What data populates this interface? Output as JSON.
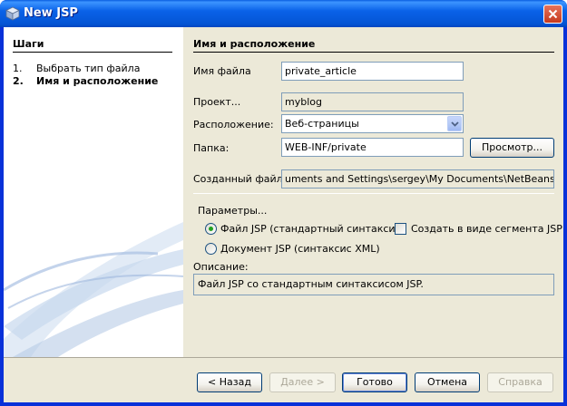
{
  "window": {
    "title": "New JSP",
    "icon": "netbeans-cube-icon"
  },
  "steps": {
    "title": "Шаги",
    "items": [
      {
        "num": "1.",
        "label": "Выбрать тип файла",
        "current": false
      },
      {
        "num": "2.",
        "label": "Имя и расположение",
        "current": true
      }
    ]
  },
  "form": {
    "section_title": "Имя и расположение",
    "file_name": {
      "label": "Имя файла",
      "value": "private_article"
    },
    "project": {
      "label": "Проект...",
      "value": "myblog"
    },
    "location": {
      "label": "Расположение:",
      "value": "Веб-страницы"
    },
    "folder": {
      "label": "Папка:",
      "value": "WEB-INF/private",
      "browse_label": "Просмотр..."
    },
    "created_file": {
      "label": "Созданный файл:",
      "value": "uments and Settings\\sergey\\My Documents\\NetBeansProjects"
    }
  },
  "params": {
    "title": "Параметры...",
    "radio_jsp": {
      "label": "Файл JSP (стандартный синтаксис)",
      "selected": true
    },
    "radio_xml": {
      "label": "Документ JSP (синтаксис XML)",
      "selected": false
    },
    "segment_checkbox": {
      "label": "Создать в виде сегмента JSP",
      "checked": false
    },
    "description_label": "Описание:",
    "description_text": "Файл JSP со стандартным синтаксисом JSP."
  },
  "buttons": {
    "back": "< Назад",
    "next": "Далее >",
    "finish": "Готово",
    "cancel": "Отмена",
    "help": "Справка"
  },
  "colors": {
    "titlebar": "#0a62e8",
    "dialog_bg": "#ece9d8",
    "radio_selected": "#21a121"
  }
}
